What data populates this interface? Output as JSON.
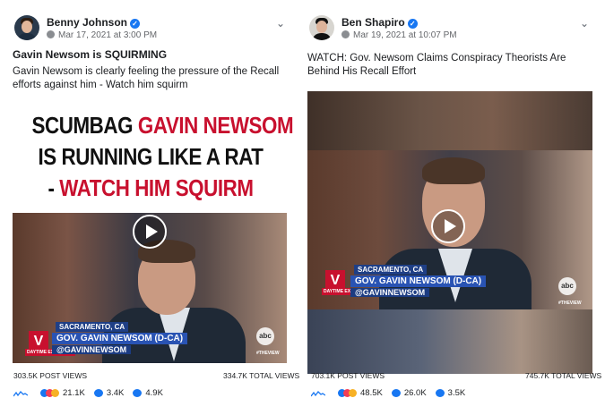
{
  "posts": [
    {
      "author": "Benny Johnson",
      "date": "Mar 17, 2021 at 3:00 PM",
      "title": "Gavin Newsom is SQUIRMING",
      "description": "Gavin Newsom is clearly feeling the pressure of the Recall efforts against him - Watch him squirm",
      "banner": {
        "line1_dark": "SCUMBAG",
        "line1_red": "GAVIN NEWSOM",
        "line2_dark": "IS RUNNING LIKE A RAT",
        "line3_dark": "-",
        "line3_red": "WATCH HIM SQUIRM"
      },
      "video": {
        "location": "SACRAMENTO, CA",
        "name": "GOV. GAVIN NEWSOM (D-CA)",
        "handle": "@GAVINNEWSOM",
        "tag": "DAYTIME EXCLUSIVE",
        "logo": "abc",
        "watermark": "#THEVIEW"
      },
      "post_views": "303.5K POST VIEWS",
      "total_views": "334.7K TOTAL VIEWS",
      "reactions": "21.1K",
      "comments": "3.4K",
      "shares": "4.9K"
    },
    {
      "author": "Ben Shapiro",
      "date": "Mar 19, 2021 at 10:07 PM",
      "title": "",
      "description": "WATCH: Gov. Newsom Claims Conspiracy Theorists Are Behind His Recall Effort",
      "video": {
        "location": "SACRAMENTO, CA",
        "name": "GOV. GAVIN NEWSOM (D-CA)",
        "handle": "@GAVINNEWSOM",
        "tag": "DAYTIME EXCLUSIVE",
        "logo": "abc",
        "watermark": "#THEVIEW"
      },
      "post_views": "703.1K POST VIEWS",
      "total_views": "745.7K TOTAL VIEWS",
      "reactions": "48.5K",
      "comments": "26.0K",
      "shares": "3.5K"
    }
  ],
  "icons": {
    "verified": "verified-badge-icon",
    "privacy": "globe-icon",
    "menu": "chevron-down-icon",
    "play": "play-icon",
    "analytics": "sparkline-icon",
    "reactions": [
      "like-icon",
      "love-icon",
      "haha-icon"
    ],
    "comments": "comment-icon",
    "shares": "share-icon"
  },
  "colors": {
    "verified": "#1877f2",
    "banner_red": "#c8102e",
    "lower_third_blue": "#2953b3"
  }
}
